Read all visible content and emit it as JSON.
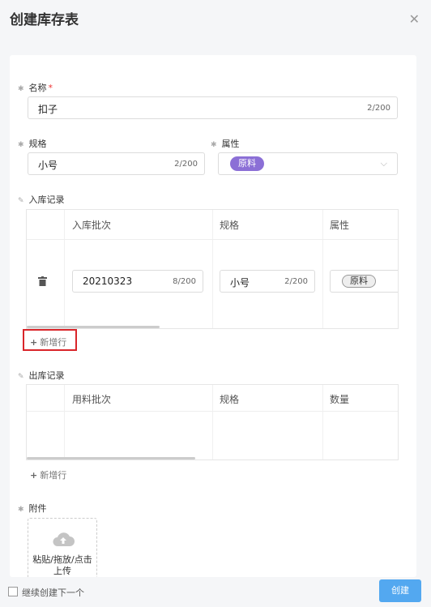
{
  "dialog": {
    "title": "创建库存表"
  },
  "form": {
    "name": {
      "label": "名称",
      "required_mark": "*",
      "value": "扣子",
      "count": "2/200"
    },
    "spec": {
      "label": "规格",
      "value": "小号",
      "count": "2/200"
    },
    "attribute": {
      "label": "属性",
      "value": "原料"
    }
  },
  "inbound": {
    "label": "入库记录",
    "headers": [
      "入库批次",
      "规格",
      "属性"
    ],
    "row": {
      "batch": "20210323",
      "batch_count": "8/200",
      "spec": "小号",
      "spec_count": "2/200",
      "attr": "原料"
    },
    "add_row": "新增行"
  },
  "outbound": {
    "label": "出库记录",
    "headers": [
      "用料批次",
      "规格",
      "数量"
    ],
    "add_row": "新增行"
  },
  "attachment": {
    "label": "附件",
    "upload_text": "粘贴/拖放/点击上传"
  },
  "footer": {
    "continue_label": "继续创建下一个",
    "create_label": "创建"
  },
  "colors": {
    "primary": "#53a8f0",
    "tag_purple": "#8b6fd6",
    "highlight_red": "#d9252a"
  }
}
